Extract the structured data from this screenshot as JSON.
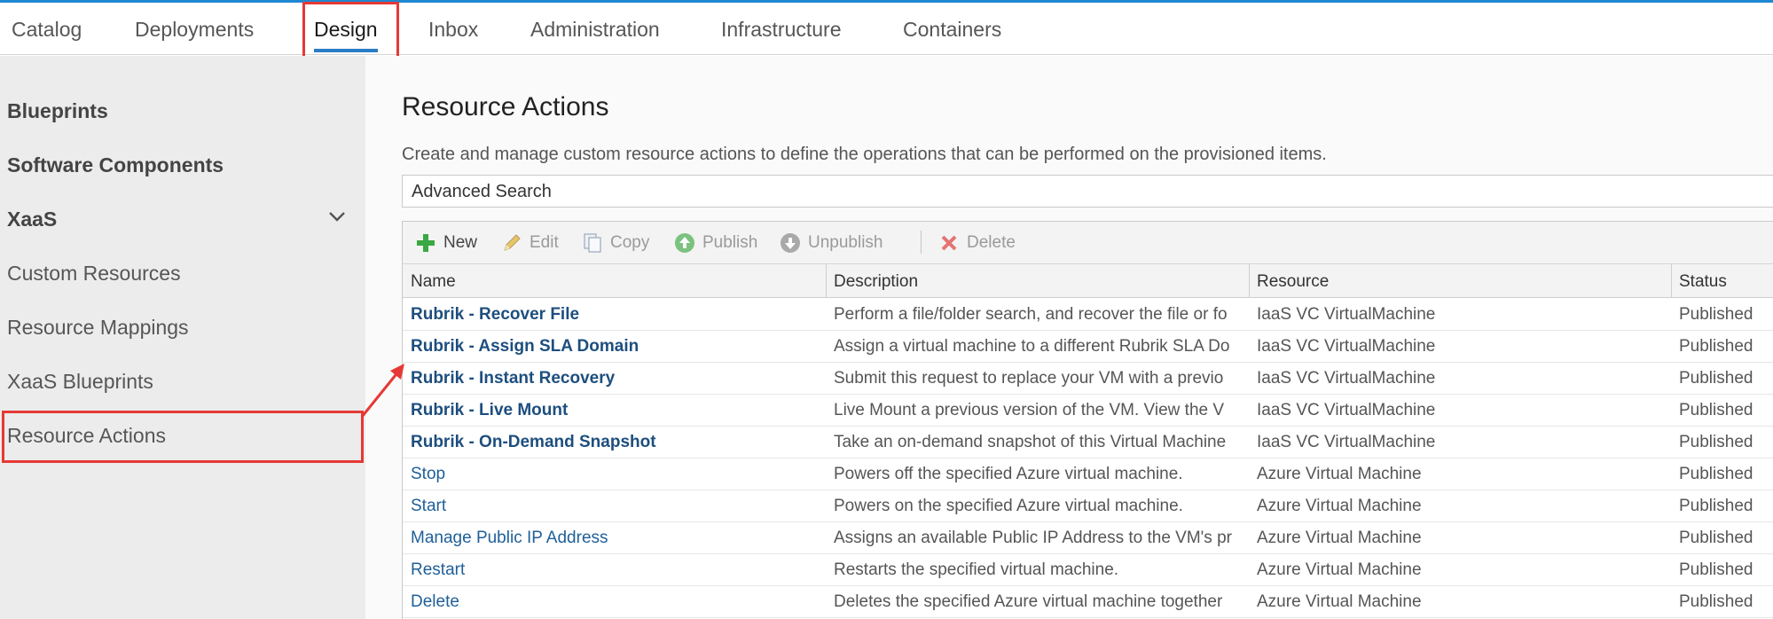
{
  "nav": {
    "tabs": [
      {
        "label": "Catalog"
      },
      {
        "label": "Deployments"
      },
      {
        "label": "Design"
      },
      {
        "label": "Inbox"
      },
      {
        "label": "Administration"
      },
      {
        "label": "Infrastructure"
      },
      {
        "label": "Containers"
      }
    ],
    "active": "Design"
  },
  "sidebar": {
    "items": [
      {
        "label": "Blueprints"
      },
      {
        "label": "Software Components"
      },
      {
        "label": "XaaS"
      },
      {
        "label": "Custom Resources"
      },
      {
        "label": "Resource Mappings"
      },
      {
        "label": "XaaS Blueprints"
      },
      {
        "label": "Resource Actions"
      }
    ],
    "selected": "Resource Actions"
  },
  "main": {
    "title": "Resource Actions",
    "description": "Create and manage custom resource actions to define the operations that can be performed on the provisioned items.",
    "advanced_search": "Advanced Search",
    "toolbar": {
      "new": "New",
      "edit": "Edit",
      "copy": "Copy",
      "publish": "Publish",
      "unpublish": "Unpublish",
      "delete": "Delete"
    },
    "columns": {
      "name": "Name",
      "description": "Description",
      "resource": "Resource",
      "status": "Status"
    },
    "rows": [
      {
        "name": "Rubrik - Recover File",
        "description": "Perform a file/folder search, and recover the file or fo",
        "resource": "IaaS VC VirtualMachine",
        "status": "Published"
      },
      {
        "name": "Rubrik - Assign SLA Domain",
        "description": "Assign a virtual machine to a different Rubrik SLA Do",
        "resource": "IaaS VC VirtualMachine",
        "status": "Published"
      },
      {
        "name": "Rubrik - Instant Recovery",
        "description": "Submit this request to replace your VM with a previo",
        "resource": "IaaS VC VirtualMachine",
        "status": "Published"
      },
      {
        "name": "Rubrik - Live Mount",
        "description": "Live Mount a previous version of the VM. View the V",
        "resource": "IaaS VC VirtualMachine",
        "status": "Published"
      },
      {
        "name": "Rubrik - On-Demand Snapshot",
        "description": "Take an on-demand snapshot of this Virtual Machine",
        "resource": "IaaS VC VirtualMachine",
        "status": "Published"
      },
      {
        "name": "Stop",
        "description": "Powers off the specified Azure virtual machine.",
        "resource": "Azure Virtual Machine",
        "status": "Published"
      },
      {
        "name": "Start",
        "description": "Powers on the specified Azure virtual machine.",
        "resource": "Azure Virtual Machine",
        "status": "Published"
      },
      {
        "name": "Manage Public IP Address",
        "description": "Assigns an available Public IP Address to the VM's pr",
        "resource": "Azure Virtual Machine",
        "status": "Published"
      },
      {
        "name": "Restart",
        "description": "Restarts the specified virtual machine.",
        "resource": "Azure Virtual Machine",
        "status": "Published"
      },
      {
        "name": "Delete",
        "description": "Deletes the specified Azure virtual machine together",
        "resource": "Azure Virtual Machine",
        "status": "Published"
      }
    ]
  },
  "colors": {
    "accent": "#2a7dc5",
    "highlight": "#e53935",
    "link": "#1f5f99"
  }
}
